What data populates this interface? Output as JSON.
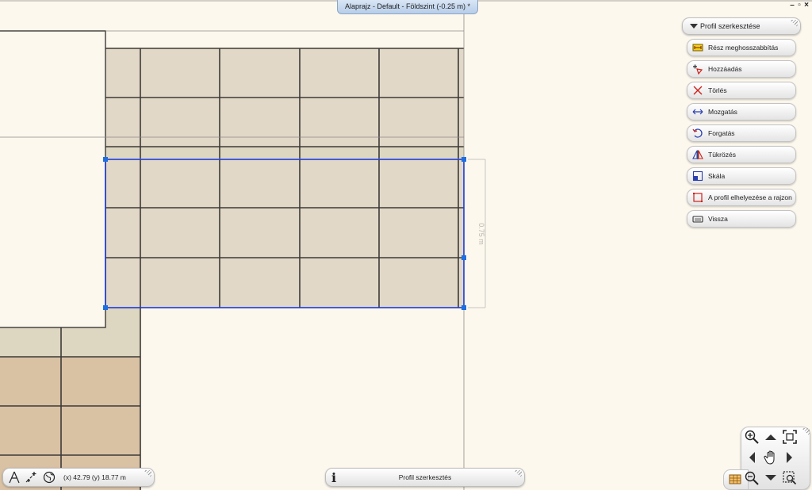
{
  "window": {
    "title": "Alaprajz - Default - Földszint (-0.25 m) *",
    "controls": {
      "minimize": "–",
      "restore": "▫",
      "close": "×"
    }
  },
  "drawing": {
    "dimension_label": "0.75 m",
    "colors": {
      "background": "#fdf8ee",
      "tile_light": "#e2d8c8",
      "tile_gray": "#ddd6c1",
      "tile_tan": "#d9c1a4",
      "grout": "#3c3a36",
      "selection": "#1a3ad8",
      "handle": "#1f6fe0"
    }
  },
  "panel": {
    "header_label": "Profil szerkesztése",
    "items": [
      {
        "label": "Rész meghosszabbítás",
        "icon": "extend-segment-icon"
      },
      {
        "label": "Hozzáadás",
        "icon": "add-node-icon"
      },
      {
        "label": "Törlés",
        "icon": "delete-icon"
      },
      {
        "label": "Mozgatás",
        "icon": "move-icon"
      },
      {
        "label": "Forgatás",
        "icon": "rotate-icon"
      },
      {
        "label": "Tükrözés",
        "icon": "mirror-icon"
      },
      {
        "label": "Skála",
        "icon": "scale-icon"
      },
      {
        "label": "A profil elhelyezése a rajzon",
        "icon": "place-profile-icon"
      },
      {
        "label": "Vissza",
        "icon": "back-icon"
      }
    ]
  },
  "coords": {
    "text": "(x) 42.79   (y) 18.77 m",
    "icons": [
      "north-arrow-icon",
      "snap-point-icon",
      "globe-icon"
    ]
  },
  "status": {
    "text": "Profil szerkesztés",
    "icon": "info-icon"
  },
  "navigation": {
    "icons": [
      "zoom-in-icon",
      "pan-up-icon",
      "zoom-extents-icon",
      "pan-left-icon",
      "hand-pan-icon",
      "pan-right-icon",
      "zoom-out-icon",
      "pan-down-icon",
      "zoom-window-icon",
      "layer-icon"
    ]
  }
}
